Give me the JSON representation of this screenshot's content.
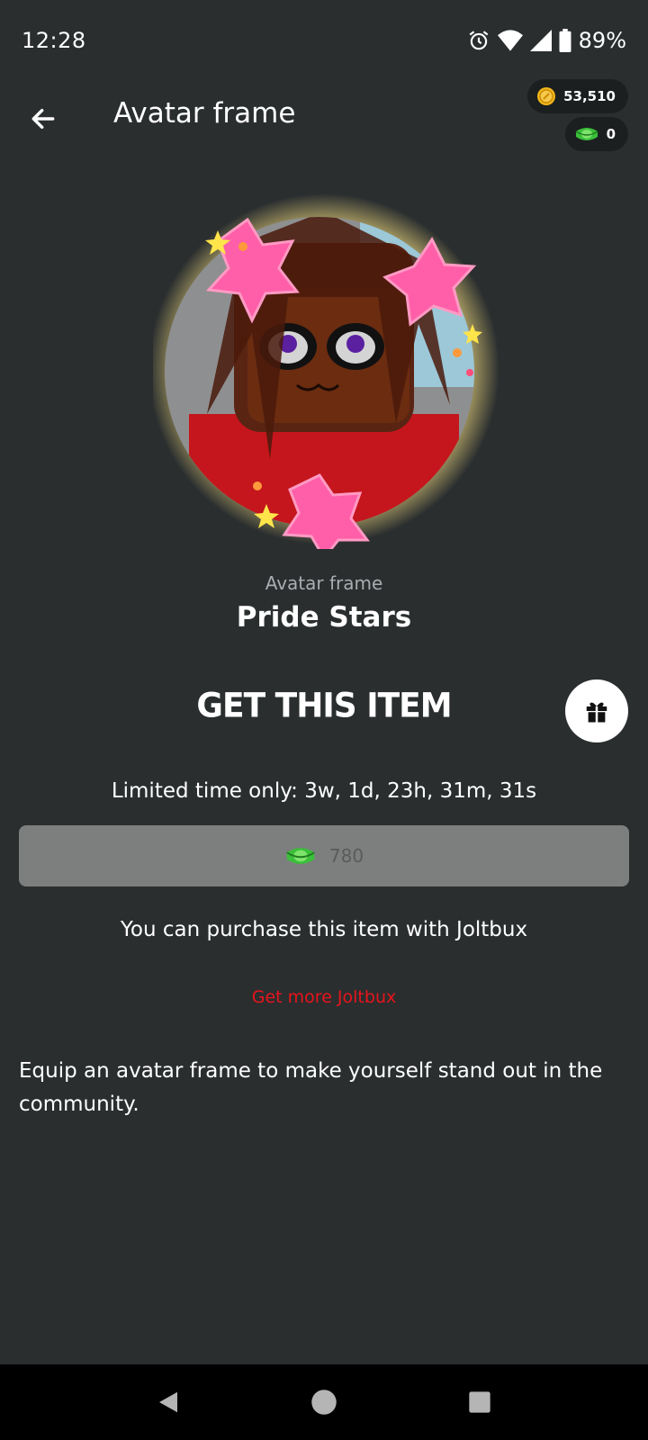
{
  "status_bar": {
    "time": "12:28",
    "battery": "89%",
    "icons": [
      "alarm-icon",
      "wifi-icon",
      "signal-icon",
      "battery-icon"
    ]
  },
  "app_bar": {
    "title": "Avatar frame",
    "back_icon": "arrow-left-icon"
  },
  "balances": {
    "coins": "53,510",
    "joltbux": "0"
  },
  "item": {
    "category": "Avatar frame",
    "name": "Pride Stars"
  },
  "purchase": {
    "title": "GET THIS ITEM",
    "timer": "Limited time only: 3w, 1d, 23h, 31m, 31s",
    "price": "780",
    "note": "You can purchase this item with Joltbux",
    "get_more": "Get more Joltbux"
  },
  "description": "Equip an avatar frame to make yourself stand out in the community.",
  "colors": {
    "background": "#2a2e2f",
    "price_button": "#7d7e7e",
    "link": "#e8141b",
    "star_pink": "#ff5fa8",
    "frame_gold": "#e8d27a"
  }
}
